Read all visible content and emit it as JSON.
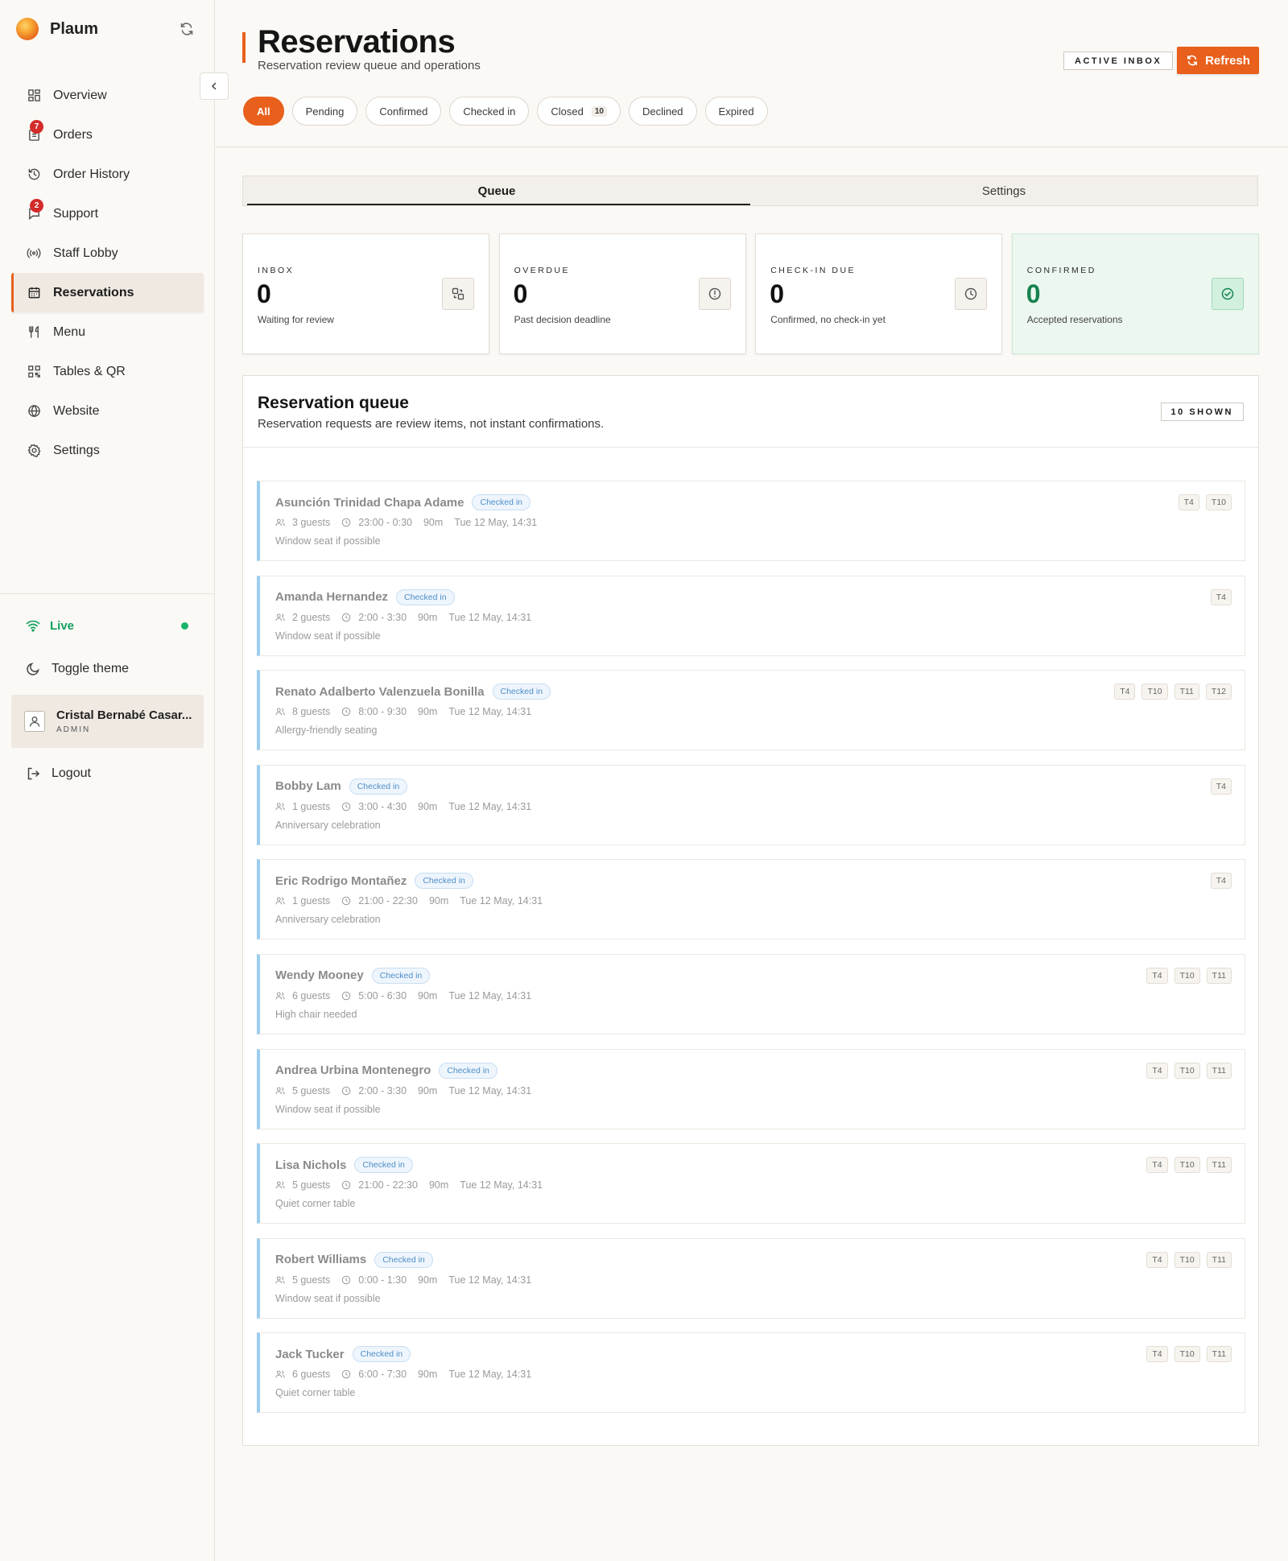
{
  "sidebar": {
    "brand": "Plaum",
    "nav": [
      {
        "label": "Overview",
        "icon": "grid-icon",
        "badge": null,
        "active": false
      },
      {
        "label": "Orders",
        "icon": "clipboard-icon",
        "badge": "7",
        "active": false
      },
      {
        "label": "Order History",
        "icon": "history-icon",
        "badge": null,
        "active": false
      },
      {
        "label": "Support",
        "icon": "chat-icon",
        "badge": "2",
        "active": false
      },
      {
        "label": "Staff Lobby",
        "icon": "broadcast-icon",
        "badge": null,
        "active": false
      },
      {
        "label": "Reservations",
        "icon": "calendar-icon",
        "badge": null,
        "active": true
      },
      {
        "label": "Menu",
        "icon": "utensils-icon",
        "badge": null,
        "active": false
      },
      {
        "label": "Tables & QR",
        "icon": "qr-icon",
        "badge": null,
        "active": false
      },
      {
        "label": "Website",
        "icon": "globe-icon",
        "badge": null,
        "active": false
      },
      {
        "label": "Settings",
        "icon": "gear-icon",
        "badge": null,
        "active": false
      }
    ],
    "live_label": "Live",
    "theme_label": "Toggle theme",
    "user": {
      "name": "Cristal Bernabé Casar...",
      "role": "ADMIN"
    },
    "logout_label": "Logout"
  },
  "header": {
    "title": "Reservations",
    "subtitle": "Reservation review queue and operations",
    "inbox_badge": "ACTIVE INBOX",
    "refresh_label": "Refresh",
    "filters": [
      {
        "label": "All",
        "count": null,
        "active": true
      },
      {
        "label": "Pending",
        "count": null,
        "active": false
      },
      {
        "label": "Confirmed",
        "count": null,
        "active": false
      },
      {
        "label": "Checked in",
        "count": null,
        "active": false
      },
      {
        "label": "Closed",
        "count": "10",
        "active": false
      },
      {
        "label": "Declined",
        "count": null,
        "active": false
      },
      {
        "label": "Expired",
        "count": null,
        "active": false
      }
    ]
  },
  "tabs": {
    "queue": "Queue",
    "settings": "Settings"
  },
  "stats": [
    {
      "label": "INBOX",
      "value": "0",
      "desc": "Waiting for review",
      "icon": "transfer-icon"
    },
    {
      "label": "OVERDUE",
      "value": "0",
      "desc": "Past decision deadline",
      "icon": "alert-circle-icon"
    },
    {
      "label": "CHECK-IN DUE",
      "value": "0",
      "desc": "Confirmed, no check-in yet",
      "icon": "clock-icon"
    },
    {
      "label": "CONFIRMED",
      "value": "0",
      "desc": "Accepted reservations",
      "icon": "check-circle-icon"
    }
  ],
  "queue": {
    "title": "Reservation queue",
    "subtitle": "Reservation requests are review items, not instant confirmations.",
    "shown": "10 SHOWN",
    "items": [
      {
        "name": "Asunción Trinidad Chapa Adame",
        "status": "Checked in",
        "guests": "3 guests",
        "time": "23:00 - 0:30",
        "duration": "90m",
        "date": "Tue 12 May, 14:31",
        "note": "Window seat if possible",
        "tables": [
          "T4",
          "T10"
        ]
      },
      {
        "name": "Amanda Hernandez",
        "status": "Checked in",
        "guests": "2 guests",
        "time": "2:00 - 3:30",
        "duration": "90m",
        "date": "Tue 12 May, 14:31",
        "note": "Window seat if possible",
        "tables": [
          "T4"
        ]
      },
      {
        "name": "Renato Adalberto Valenzuela Bonilla",
        "status": "Checked in",
        "guests": "8 guests",
        "time": "8:00 - 9:30",
        "duration": "90m",
        "date": "Tue 12 May, 14:31",
        "note": "Allergy-friendly seating",
        "tables": [
          "T4",
          "T10",
          "T11",
          "T12"
        ]
      },
      {
        "name": "Bobby Lam",
        "status": "Checked in",
        "guests": "1 guests",
        "time": "3:00 - 4:30",
        "duration": "90m",
        "date": "Tue 12 May, 14:31",
        "note": "Anniversary celebration",
        "tables": [
          "T4"
        ]
      },
      {
        "name": "Eric Rodrigo Montañez",
        "status": "Checked in",
        "guests": "1 guests",
        "time": "21:00 - 22:30",
        "duration": "90m",
        "date": "Tue 12 May, 14:31",
        "note": "Anniversary celebration",
        "tables": [
          "T4"
        ]
      },
      {
        "name": "Wendy Mooney",
        "status": "Checked in",
        "guests": "6 guests",
        "time": "5:00 - 6:30",
        "duration": "90m",
        "date": "Tue 12 May, 14:31",
        "note": "High chair needed",
        "tables": [
          "T4",
          "T10",
          "T11"
        ]
      },
      {
        "name": "Andrea Urbina Montenegro",
        "status": "Checked in",
        "guests": "5 guests",
        "time": "2:00 - 3:30",
        "duration": "90m",
        "date": "Tue 12 May, 14:31",
        "note": "Window seat if possible",
        "tables": [
          "T4",
          "T10",
          "T11"
        ]
      },
      {
        "name": "Lisa Nichols",
        "status": "Checked in",
        "guests": "5 guests",
        "time": "21:00 - 22:30",
        "duration": "90m",
        "date": "Tue 12 May, 14:31",
        "note": "Quiet corner table",
        "tables": [
          "T4",
          "T10",
          "T11"
        ]
      },
      {
        "name": "Robert Williams",
        "status": "Checked in",
        "guests": "5 guests",
        "time": "0:00 - 1:30",
        "duration": "90m",
        "date": "Tue 12 May, 14:31",
        "note": "Window seat if possible",
        "tables": [
          "T4",
          "T10",
          "T11"
        ]
      },
      {
        "name": "Jack Tucker",
        "status": "Checked in",
        "guests": "6 guests",
        "time": "6:00 - 7:30",
        "duration": "90m",
        "date": "Tue 12 May, 14:31",
        "note": "Quiet corner table",
        "tables": [
          "T4",
          "T10",
          "T11"
        ]
      }
    ]
  },
  "colors": {
    "accent": "#e8601c",
    "live": "#12a05c",
    "checked_in": "#4f8fc8",
    "confirmed": "#16834f"
  }
}
